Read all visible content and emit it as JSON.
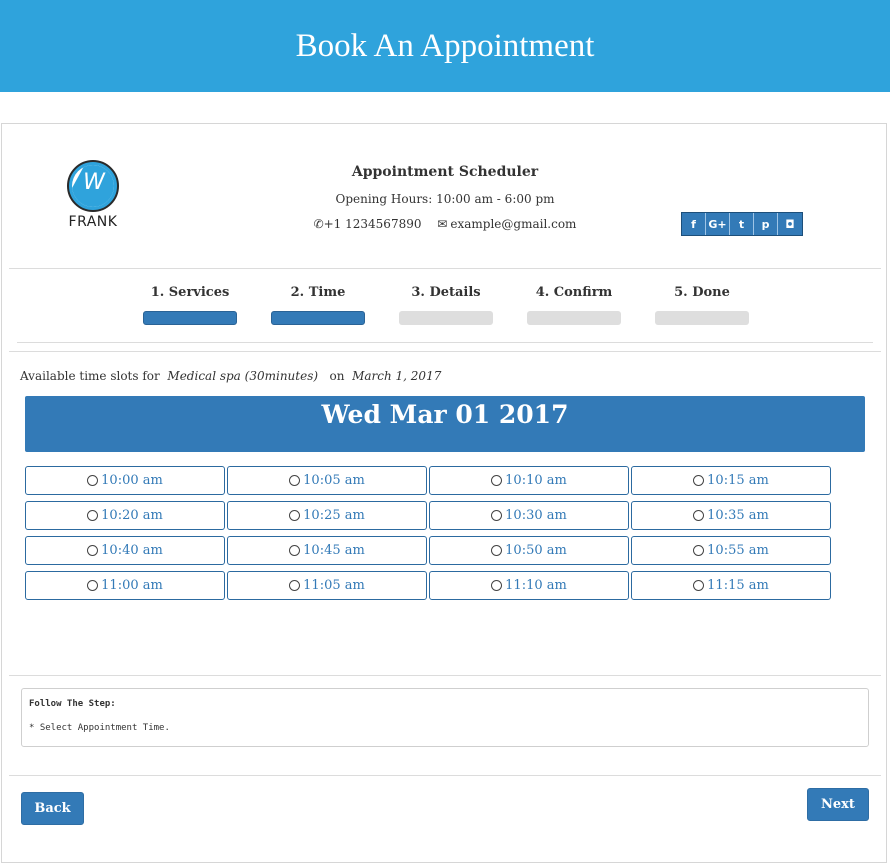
{
  "header": {
    "title": "Book An Appointment"
  },
  "business": {
    "logo_text": "W",
    "brand": "FRANK",
    "name": "Appointment Scheduler",
    "hours": "Opening Hours: 10:00 am - 6:00 pm",
    "phone": "+1 1234567890",
    "email": "example@gmail.com"
  },
  "social": [
    {
      "name": "facebook",
      "glyph": "f"
    },
    {
      "name": "google-plus",
      "glyph": "G+"
    },
    {
      "name": "twitter",
      "glyph": "t"
    },
    {
      "name": "pinterest",
      "glyph": "p"
    },
    {
      "name": "instagram",
      "glyph": "◘"
    }
  ],
  "steps": [
    {
      "label": "1. Services",
      "active": true
    },
    {
      "label": "2. Time",
      "active": true
    },
    {
      "label": "3. Details",
      "active": false
    },
    {
      "label": "4. Confirm",
      "active": false
    },
    {
      "label": "5. Done",
      "active": false
    }
  ],
  "availability": {
    "prefix": "Available time slots for",
    "service": "Medical spa (30minutes)",
    "on": "on",
    "date": "March 1, 2017"
  },
  "date_heading": "Wed Mar 01 2017",
  "slots": [
    "10:00 am",
    "10:05 am",
    "10:10 am",
    "10:15 am",
    "10:20 am",
    "10:25 am",
    "10:30 am",
    "10:35 am",
    "10:40 am",
    "10:45 am",
    "10:50 am",
    "10:55 am",
    "11:00 am",
    "11:05 am",
    "11:10 am",
    "11:15 am"
  ],
  "instructions": {
    "heading": "Follow The Step:",
    "text": "* Select Appointment Time."
  },
  "buttons": {
    "back": "Back",
    "next": "Next"
  },
  "colors": {
    "header": "#2fa3dc",
    "primary": "#337ab7",
    "inactive": "#dedede"
  }
}
